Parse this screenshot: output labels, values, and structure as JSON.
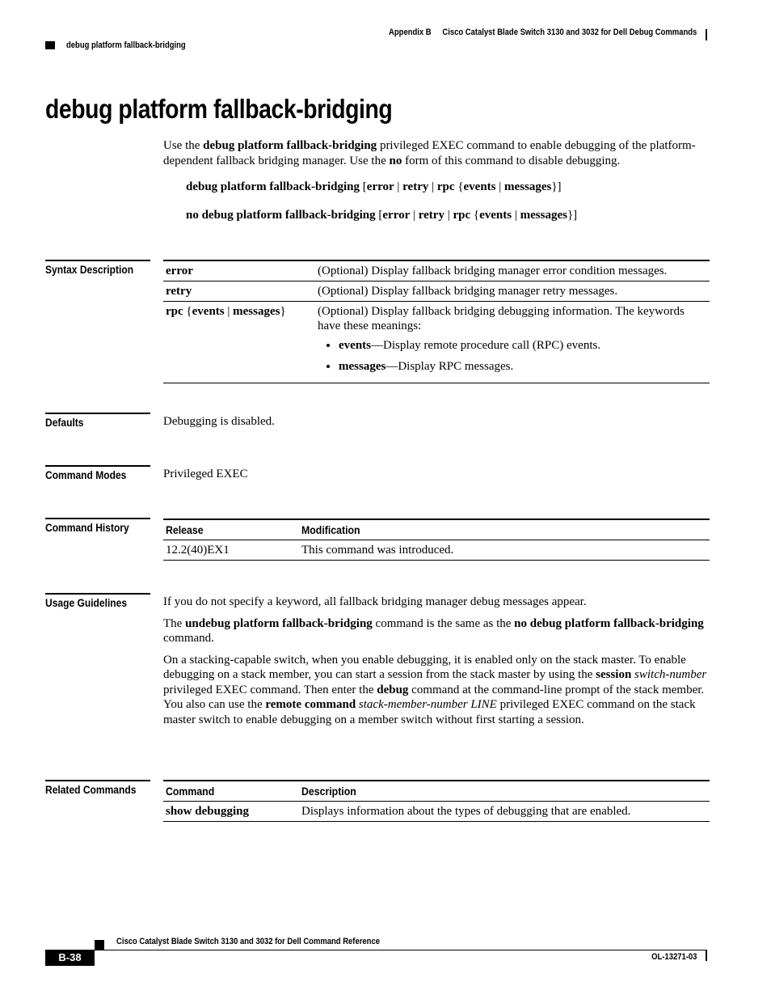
{
  "header": {
    "appendix": "Appendix B",
    "chapter_title": "Cisco Catalyst Blade Switch 3130 and 3032 for Dell Debug Commands",
    "running_head": "debug platform fallback-bridging"
  },
  "title": "debug platform fallback-bridging",
  "intro": {
    "p1": "Use the ",
    "cmd": "debug platform fallback-bridging",
    "p2": " privileged EXEC command to enable debugging of the platform-dependent fallback bridging manager. Use the ",
    "no": "no",
    "p3": " form of this command to disable debugging."
  },
  "syntax": {
    "line1": {
      "cmd": "debug platform fallback-bridging",
      "o1": " [",
      "k1": "error",
      "s1": " | ",
      "k2": "retry",
      "s2": " | ",
      "k3": "rpc",
      "o2": " {",
      "k4": "events",
      "s3": " | ",
      "k5": "messages",
      "o3": "}]"
    },
    "line2": {
      "cmd": "no debug platform fallback-bridging",
      "o1": " [",
      "k1": "error",
      "s1": " | ",
      "k2": "retry",
      "s2": " | ",
      "k3": "rpc",
      "o2": " {",
      "k4": "events",
      "s3": " | ",
      "k5": "messages",
      "o3": "}]"
    }
  },
  "sections": {
    "syntax_description": "Syntax Description",
    "defaults": "Defaults",
    "command_modes": "Command Modes",
    "command_history": "Command History",
    "usage_guidelines": "Usage Guidelines",
    "related_commands": "Related Commands"
  },
  "syntax_table": {
    "rows": [
      {
        "keyword": "error",
        "description": "(Optional) Display fallback bridging manager error condition messages."
      },
      {
        "keyword": "retry",
        "description": "(Optional) Display fallback bridging manager retry messages."
      },
      {
        "keyword_a": "rpc",
        "keyword_b": " {",
        "keyword_c": "events",
        "keyword_d": " | ",
        "keyword_e": "messages",
        "keyword_f": "}",
        "description": "(Optional) Display fallback bridging debugging information. The keywords have these meanings:",
        "bullets": [
          {
            "term": "events",
            "text": "—Display remote procedure call (RPC) events."
          },
          {
            "term": "messages",
            "text": "—Display RPC messages."
          }
        ]
      }
    ]
  },
  "defaults": "Debugging is disabled.",
  "command_modes": "Privileged EXEC",
  "history_table": {
    "headers": [
      "Release",
      "Modification"
    ],
    "rows": [
      [
        "12.2(40)EX1",
        "This command was introduced."
      ]
    ]
  },
  "usage": {
    "p1": "If you do not specify a keyword, all fallback bridging manager debug messages appear.",
    "p2": {
      "a": "The ",
      "b": "undebug platform fallback-bridging",
      "c": " command is the same as the ",
      "d": "no debug platform fallback-bridging",
      "e": " command."
    },
    "p3": {
      "a": "On a stacking-capable switch, when you enable debugging, it is enabled only on the stack master. To enable debugging on a stack member, you can start a session from the stack master by using the ",
      "b": "session",
      "c": " ",
      "d": "switch-number",
      "e": " privileged EXEC command. Then enter the ",
      "f": "debug",
      "g": " command at the command-line prompt of the stack member. You also can use the ",
      "h": "remote command",
      "i": " ",
      "j": "stack-member-number LINE",
      "k": " privileged EXEC command on the stack master switch to enable debugging on a member switch without first starting a session."
    }
  },
  "related_table": {
    "headers": [
      "Command",
      "Description"
    ],
    "rows": [
      [
        "show debugging",
        "Displays information about the types of debugging that are enabled."
      ]
    ]
  },
  "footer": {
    "book_title": "Cisco Catalyst Blade Switch 3130 and 3032 for Dell Command Reference",
    "page_number": "B-38",
    "doc_number": "OL-13271-03"
  }
}
